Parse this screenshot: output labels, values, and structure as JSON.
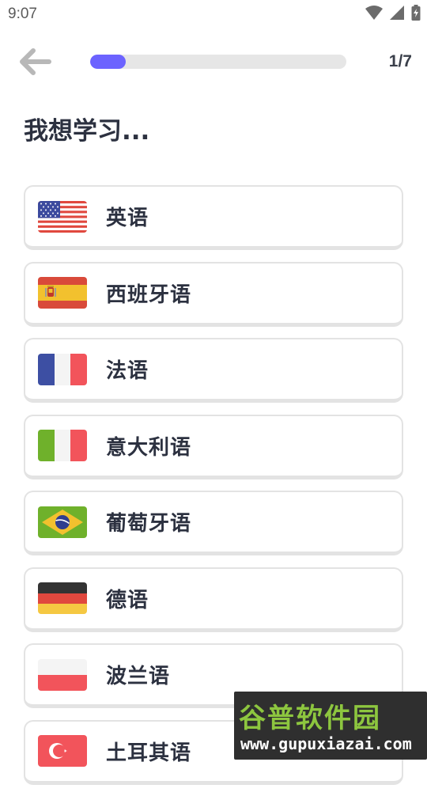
{
  "status_bar": {
    "time": "9:07",
    "icons": [
      "wifi-icon",
      "signal-icon",
      "battery-icon"
    ]
  },
  "header": {
    "back_icon": "arrow-left-icon",
    "progress_fraction": 0.14,
    "step": "1/7"
  },
  "title": "我想学习...",
  "languages": [
    {
      "label": "英语",
      "flag": "us-flag-icon"
    },
    {
      "label": "西班牙语",
      "flag": "spain-flag-icon"
    },
    {
      "label": "法语",
      "flag": "france-flag-icon"
    },
    {
      "label": "意大利语",
      "flag": "italy-flag-icon"
    },
    {
      "label": "葡萄牙语",
      "flag": "brazil-flag-icon"
    },
    {
      "label": "德语",
      "flag": "germany-flag-icon"
    },
    {
      "label": "波兰语",
      "flag": "poland-flag-icon"
    },
    {
      "label": "土耳其语",
      "flag": "turkey-flag-icon"
    }
  ],
  "watermark": {
    "name": "谷普软件园",
    "url": "www.gupuxiazai.com"
  },
  "colors": {
    "accent": "#6c63ff",
    "track": "#e6e6e6",
    "border": "#e3e3e3",
    "text": "#2c3140"
  }
}
